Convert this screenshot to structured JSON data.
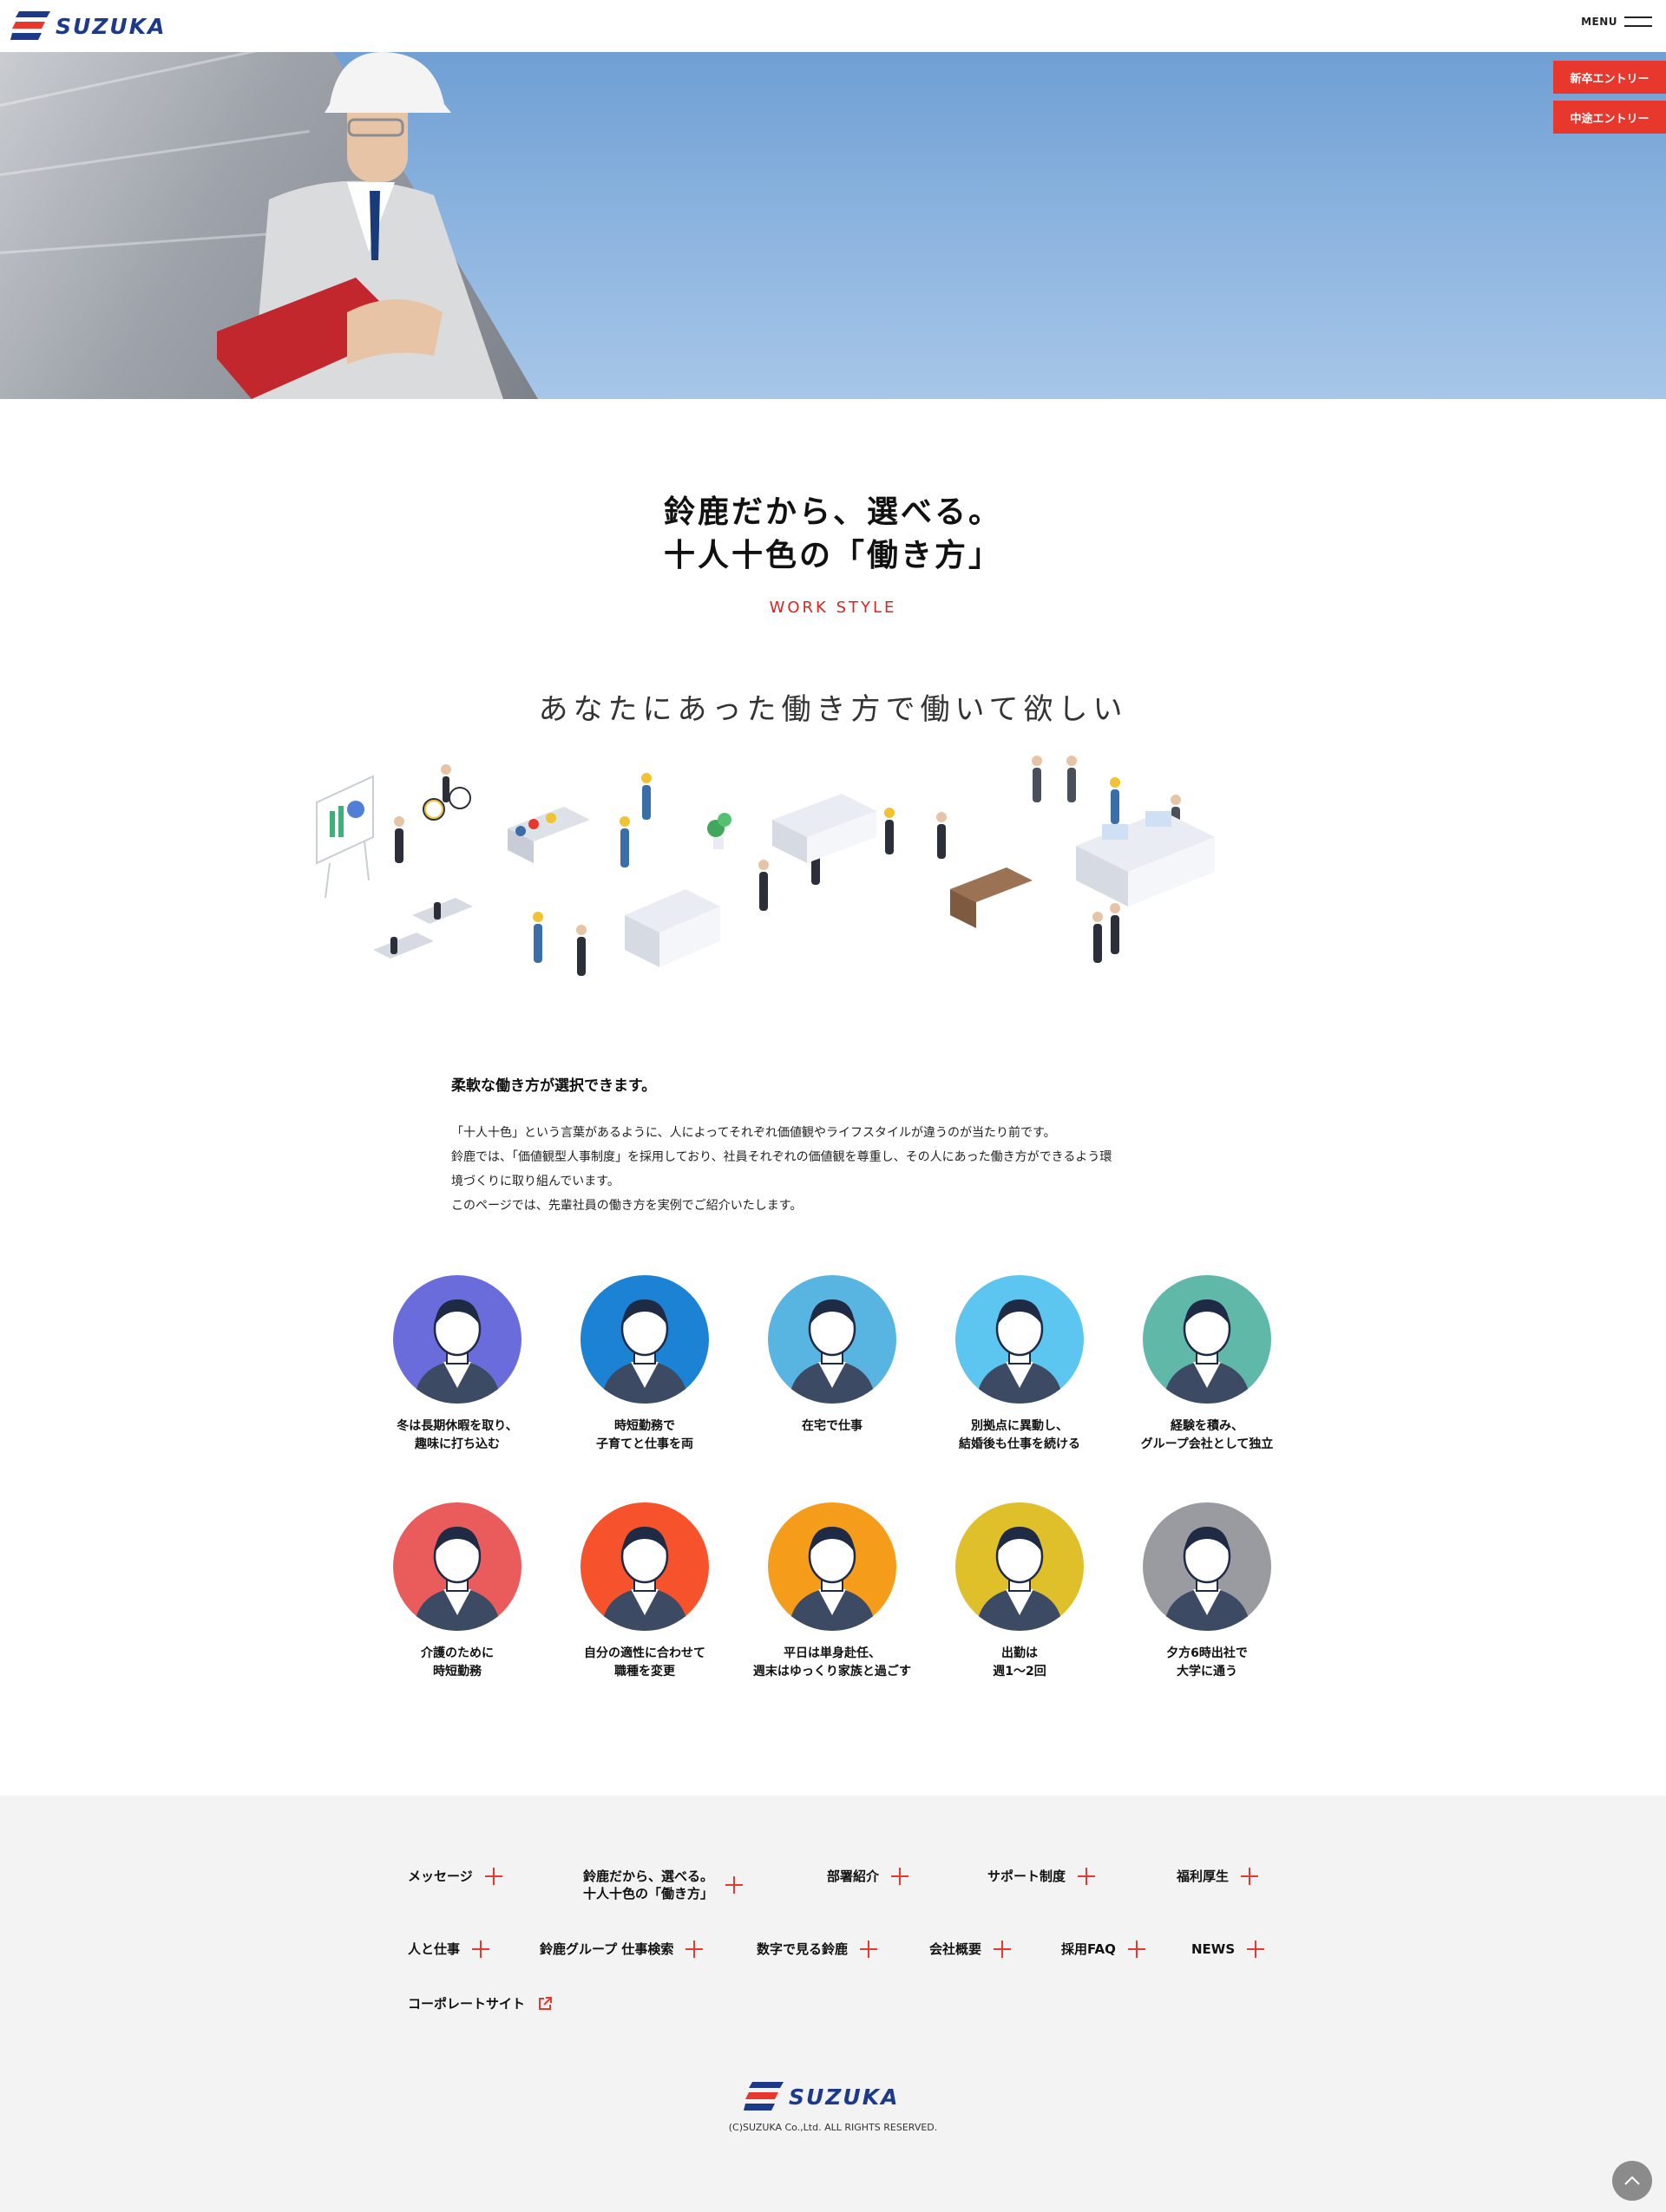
{
  "header": {
    "logo_text": "SUZUKA",
    "menu_label": "MENU"
  },
  "hero": {
    "entry_new": "新卒エントリー",
    "entry_mid": "中途エントリー"
  },
  "title": {
    "line1": "鈴鹿だから、選べる。",
    "line2": "十人十色の「働き方」",
    "sub": "WORK STYLE"
  },
  "catch": "あなたにあった働き方で働いて欲しい",
  "intro": {
    "heading": "柔軟な働き方が選択できます。",
    "lines": [
      "「十人十色」という言葉があるように、人によってそれぞれ価値観やライフスタイルが違うのが当たり前です。",
      "鈴鹿では、「価値観型人事制度」を採用しており、社員それぞれの価値観を尊重し、その人にあった働き方ができるよう環",
      "境づくりに取り組んでいます。",
      "このページでは、先輩社員の働き方を実例でご紹介いたします。"
    ]
  },
  "cards": [
    {
      "label": "冬は長期休暇を取り、\n趣味に打ち込む",
      "color": "#6a6cdc",
      "icon": "helmet-man-avatar-icon"
    },
    {
      "label": "時短勤務で\n子育てと仕事を両",
      "color": "#1c82d4",
      "icon": "woman-avatar-icon"
    },
    {
      "label": "在宅で仕事",
      "color": "#58b4e0",
      "icon": "bearded-man-avatar-icon"
    },
    {
      "label": "別拠点に異動し、\n結婚後も仕事を続ける",
      "color": "#5cc5f0",
      "icon": "woman-bun-avatar-icon"
    },
    {
      "label": "経験を積み、\nグループ会社として独立",
      "color": "#5fb8a8",
      "icon": "man-suit-avatar-icon"
    },
    {
      "label": "介護のために\n時短勤務",
      "color": "#ea5c5c",
      "icon": "mustache-man-avatar-icon"
    },
    {
      "label": "自分の適性に合わせて\n職種を変更",
      "color": "#f6532d",
      "icon": "man-shirt-avatar-icon"
    },
    {
      "label": "平日は単身赴任、\n週末はゆっくり家族と過ごす",
      "color": "#f59d1a",
      "icon": "glasses-man-avatar-icon"
    },
    {
      "label": "出勤は\n週1〜2回",
      "color": "#e0c02a",
      "icon": "helmet-worker-avatar-icon"
    },
    {
      "label": "夕方6時出社で\n大学に通う",
      "color": "#9a9ba1",
      "icon": "young-man-avatar-icon"
    }
  ],
  "footer_nav": [
    {
      "label": "メッセージ"
    },
    {
      "label": "鈴鹿だから、選べる。\n十人十色の「働き方」"
    },
    {
      "label": "部署紹介"
    },
    {
      "label": "サポート制度"
    },
    {
      "label": "福利厚生"
    },
    {
      "label": "人と仕事"
    },
    {
      "label": "鈴鹿グループ 仕事検索"
    },
    {
      "label": "数字で見る鈴鹿"
    },
    {
      "label": "会社概要"
    },
    {
      "label": "採用FAQ"
    },
    {
      "label": "NEWS"
    },
    {
      "label": "コーポレートサイト"
    }
  ],
  "footer": {
    "logo_text": "SUZUKA",
    "copyright": "(C)SUZUKA Co.,Ltd. ALL RIGHTS RESERVED."
  },
  "colors": {
    "accent": "#e8382e",
    "brand": "#1d3a8a",
    "footer_bg": "#f3f3f3"
  }
}
